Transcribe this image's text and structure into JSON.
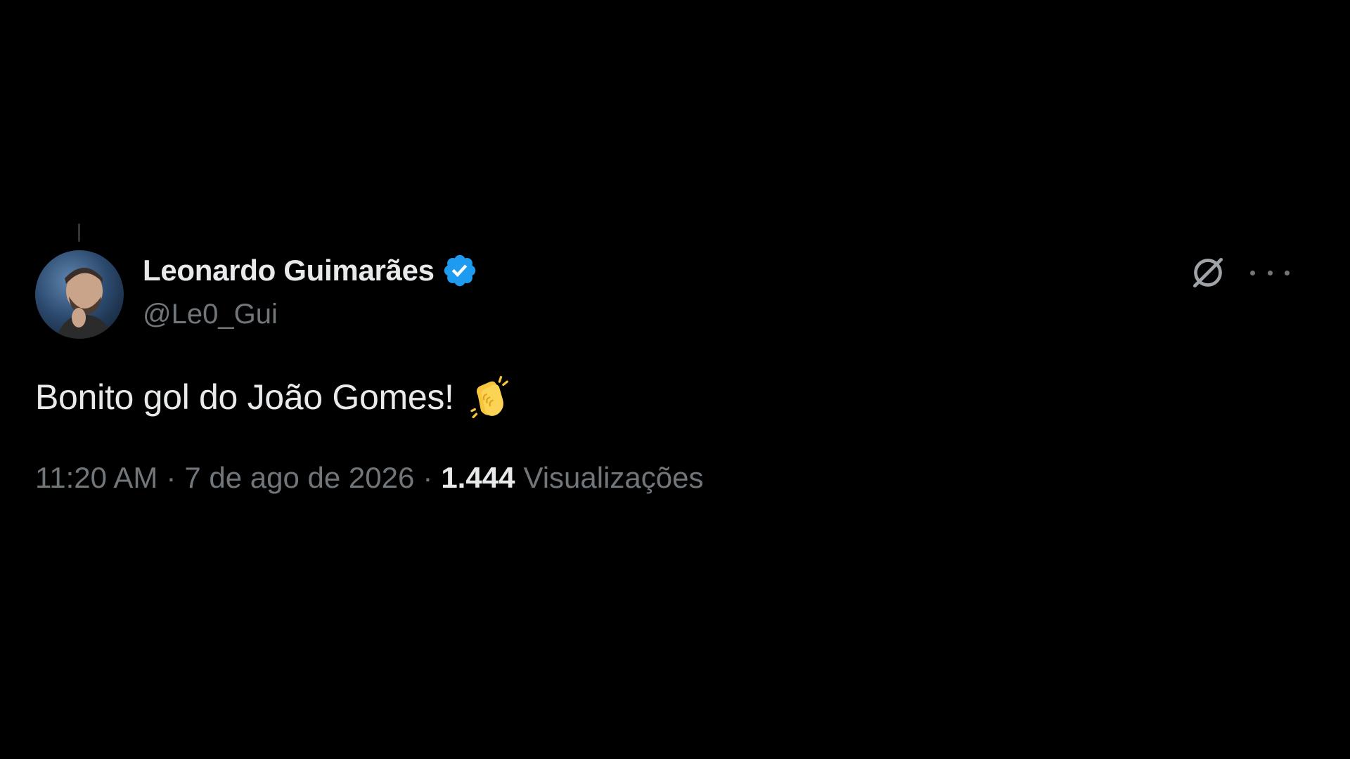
{
  "tweet": {
    "author": {
      "display_name": "Leonardo Guimarães",
      "handle": "@Le0_Gui",
      "verified": true,
      "avatar_icon": "profile-photo"
    },
    "text": "Bonito gol do João Gomes!",
    "emoji_icon": "clapping-hands-emoji",
    "time": "11:20 AM",
    "separator": "·",
    "date": "7 de ago de 2026",
    "views_count": "1.444",
    "views_label": "Visualizações"
  },
  "icons": {
    "grok": "grok-icon",
    "more": "more-options-icon",
    "verified": "verified-badge-icon"
  },
  "colors": {
    "background": "#000000",
    "primary_text": "#e7e9ea",
    "secondary_text": "#71767b",
    "verified_blue": "#1d9bf0"
  }
}
